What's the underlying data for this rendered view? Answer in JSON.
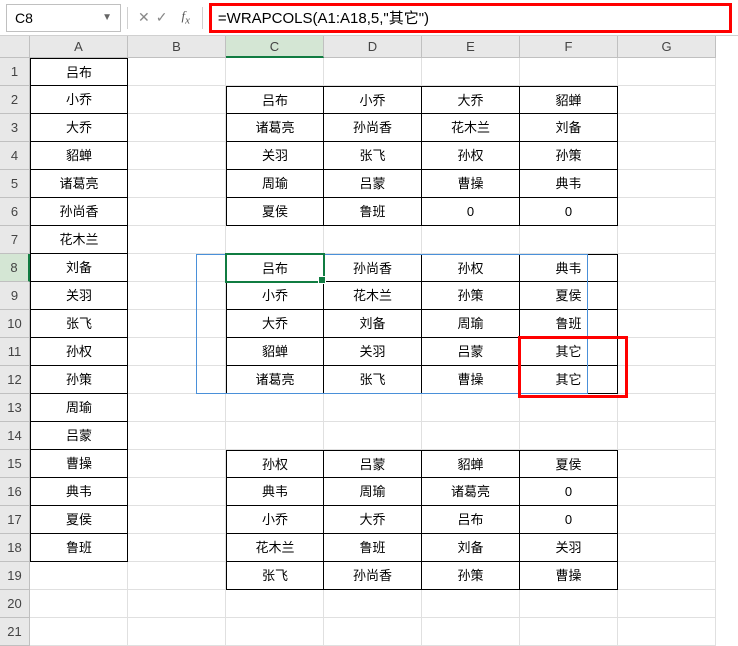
{
  "namebox": "C8",
  "formula": "=WRAPCOLS(A1:A18,5,\"其它\")",
  "col_labels": [
    "A",
    "B",
    "C",
    "D",
    "E",
    "F",
    "G"
  ],
  "row_labels": [
    "1",
    "2",
    "3",
    "4",
    "5",
    "6",
    "7",
    "8",
    "9",
    "10",
    "11",
    "12",
    "13",
    "14",
    "15",
    "16",
    "17",
    "18",
    "19",
    "20",
    "21"
  ],
  "colA": [
    "吕布",
    "小乔",
    "大乔",
    "貂蝉",
    "诸葛亮",
    "孙尚香",
    "花木兰",
    "刘备",
    "关羽",
    "张飞",
    "孙权",
    "孙策",
    "周瑜",
    "吕蒙",
    "曹操",
    "典韦",
    "夏侯",
    "鲁班"
  ],
  "block1": {
    "rows": [
      [
        "吕布",
        "小乔",
        "大乔",
        "貂蝉"
      ],
      [
        "诸葛亮",
        "孙尚香",
        "花木兰",
        "刘备"
      ],
      [
        "关羽",
        "张飞",
        "孙权",
        "孙策"
      ],
      [
        "周瑜",
        "吕蒙",
        "曹操",
        "典韦"
      ],
      [
        "夏侯",
        "鲁班",
        "0",
        "0"
      ]
    ]
  },
  "block2": {
    "rows": [
      [
        "吕布",
        "孙尚香",
        "孙权",
        "典韦"
      ],
      [
        "小乔",
        "花木兰",
        "孙策",
        "夏侯"
      ],
      [
        "大乔",
        "刘备",
        "周瑜",
        "鲁班"
      ],
      [
        "貂蝉",
        "关羽",
        "吕蒙",
        "其它"
      ],
      [
        "诸葛亮",
        "张飞",
        "曹操",
        "其它"
      ]
    ]
  },
  "block3": {
    "rows": [
      [
        "孙权",
        "吕蒙",
        "貂蝉",
        "夏侯"
      ],
      [
        "典韦",
        "周瑜",
        "诸葛亮",
        "0"
      ],
      [
        "小乔",
        "大乔",
        "吕布",
        "0"
      ],
      [
        "花木兰",
        "鲁班",
        "刘备",
        "关羽"
      ],
      [
        "张飞",
        "孙尚香",
        "孙策",
        "曹操"
      ]
    ]
  }
}
